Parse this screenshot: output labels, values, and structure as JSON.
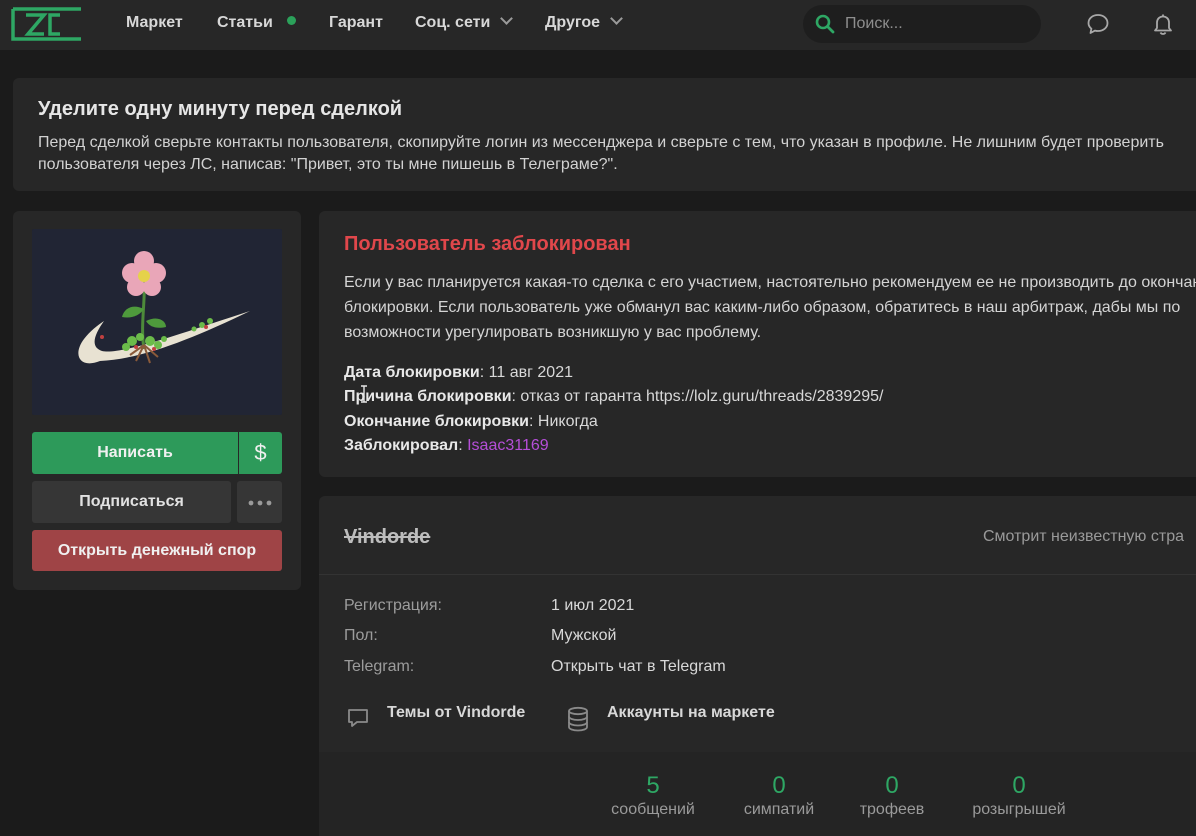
{
  "nav": {
    "items": [
      {
        "label": "Маркет"
      },
      {
        "label": "Статьи"
      },
      {
        "label": "Гарант"
      },
      {
        "label": "Соц. сети"
      },
      {
        "label": "Другое"
      }
    ],
    "search_placeholder": "Поиск...",
    "icons": [
      "logo-icon",
      "search-icon",
      "chat-icon",
      "bell-icon"
    ]
  },
  "banner": {
    "title": "Уделите одну минуту перед сделкой",
    "text": "Перед сделкой сверьте контакты пользователя, скопируйте логин из мессенджера и сверьте с тем, что указан в профиле. Не лишним будет проверить пользователя через ЛС, написав: \"Привет, это ты мне пишешь в Телеграме?\"."
  },
  "sidebar": {
    "write_label": "Написать",
    "dollar_label": "$",
    "subscribe_label": "Подписаться",
    "dispute_label": "Открыть денежный спор"
  },
  "block": {
    "title": "Пользователь заблокирован",
    "description": "Если у вас планируется какая-то сделка с его участием, настоятельно рекомендуем ее не производить до окончания блокировки. Если пользователь уже обманул вас каким-либо образом, обратитесь в наш арбитраж, дабы мы по возможности урегулировать возникшую у вас проблему.",
    "date_label": "Дата блокировки",
    "date_value": "11 авг 2021",
    "reason_label": "Причина блокировки",
    "reason_value": "отказ от гаранта https://lolz.guru/threads/2839295/",
    "end_label": "Окончание блокировки",
    "end_value": "Никогда",
    "blocker_label": "Заблокировал",
    "blocker_value": "Isaac31169"
  },
  "profile": {
    "name": "Vindorde",
    "status": "Смотрит неизвестную стра",
    "reg_label": "Регистрация:",
    "reg_value": "1 июл 2021",
    "gender_label": "Пол:",
    "gender_value": "Мужской",
    "telegram_label": "Telegram:",
    "telegram_value": "Открыть чат в Telegram",
    "threads_link": "Темы от Vindorde",
    "market_link": "Аккаунты на маркете",
    "stats": [
      {
        "value": "5",
        "label": "сообщений"
      },
      {
        "value": "0",
        "label": "симпатий"
      },
      {
        "value": "0",
        "label": "трофеев"
      },
      {
        "value": "0",
        "label": "розыгрышей"
      }
    ]
  },
  "colors": {
    "accent_green": "#2d9a5a",
    "danger_red": "#e0474b",
    "link_purple": "#b54ed8",
    "dispute_red": "#9f4446"
  }
}
